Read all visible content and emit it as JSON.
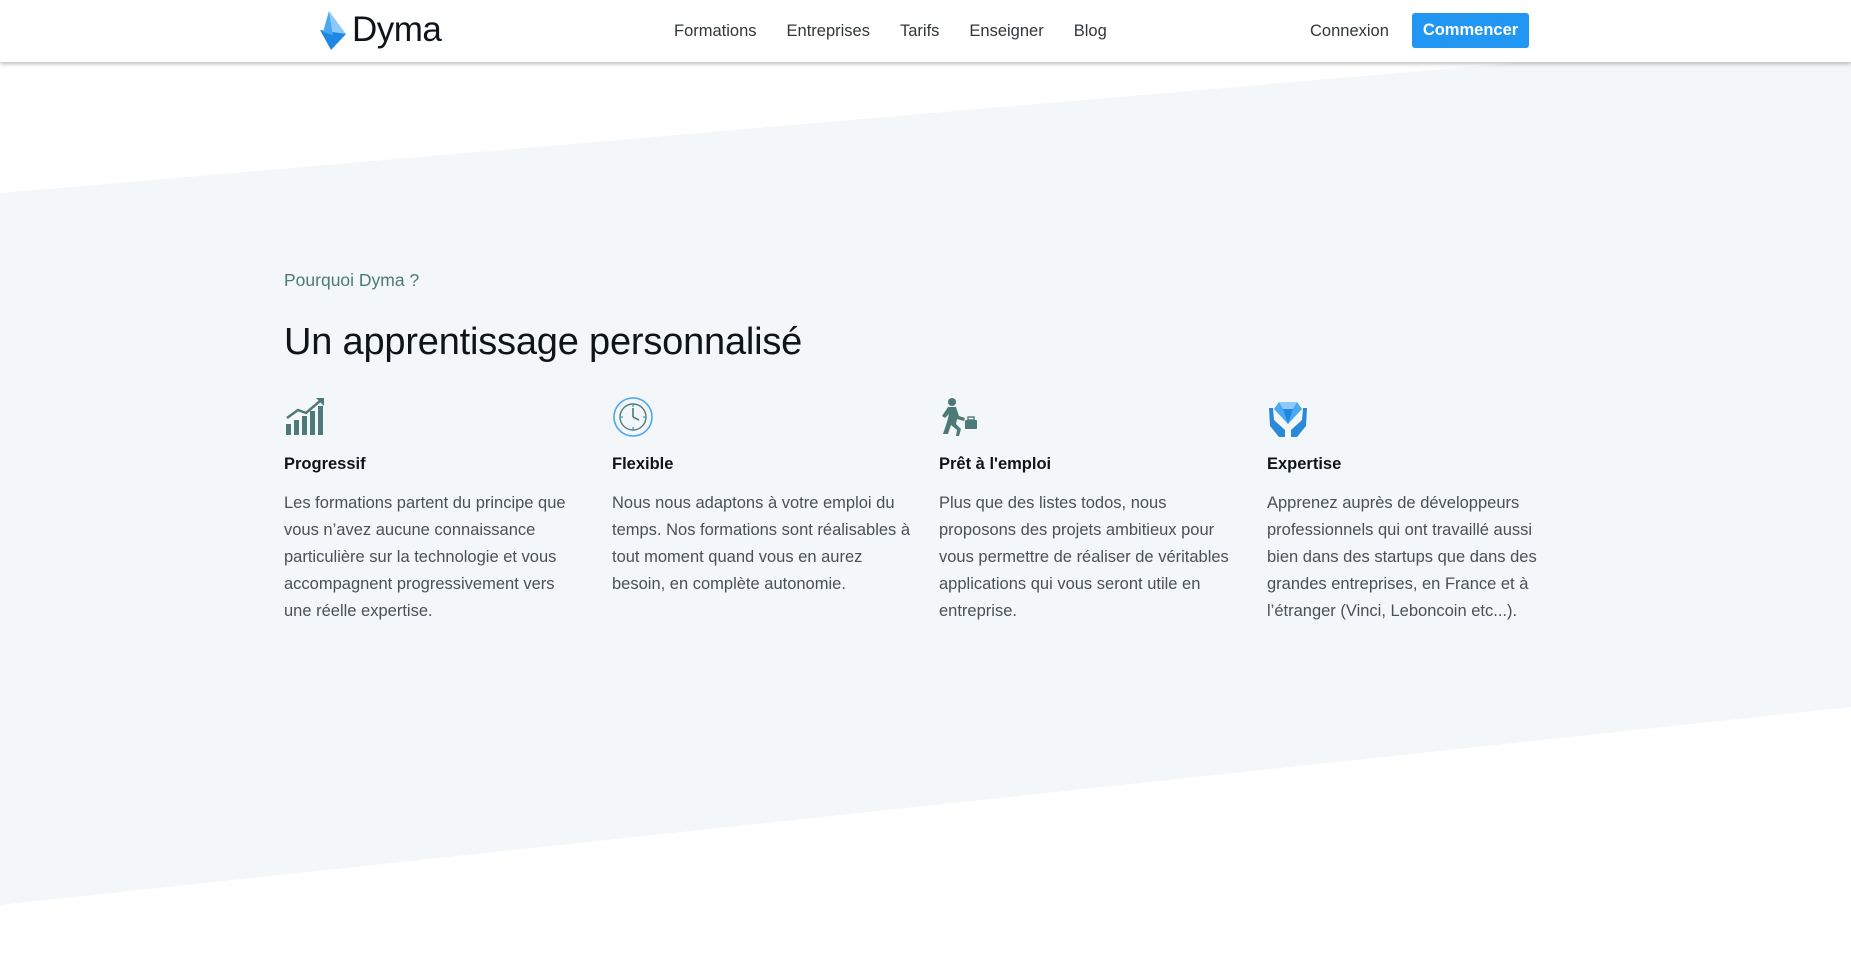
{
  "brand": {
    "name": "Dyma",
    "accent": "#2196f3",
    "teal": "#4d7a77"
  },
  "nav": {
    "links": [
      "Formations",
      "Entreprises",
      "Tarifs",
      "Enseigner",
      "Blog"
    ],
    "login_label": "Connexion",
    "cta_label": "Commencer"
  },
  "section": {
    "eyebrow": "Pourquoi Dyma ?",
    "heading": "Un apprentissage personnalisé",
    "background_color": "#f4f7fa",
    "features": [
      {
        "icon": "growth-chart-icon",
        "title": "Progressif",
        "text": "Les formations partent du principe que vous n’avez aucune connaissance particulière sur la technologie et vous accompagnent progressivement vers une réelle expertise."
      },
      {
        "icon": "clock-icon",
        "title": "Flexible",
        "text": "Nous nous adaptons à votre emploi du temps. Nos formations sont réalisables à tout moment quand vous en aurez besoin, en complète autonomie."
      },
      {
        "icon": "running-worker-icon",
        "title": "Prêt à l'emploi",
        "text": "Plus que des listes todos, nous proposons des projets ambitieux pour vous permettre de réaliser de véritables applications qui vous seront utile en entreprise."
      },
      {
        "icon": "diamond-hands-icon",
        "title": "Expertise",
        "text": "Apprenez auprès de développeurs professionnels qui ont travaillé aussi bien dans des startups que dans des grandes entreprises, en France et à l’étranger (Vinci, Leboncoin etc...)."
      }
    ]
  }
}
